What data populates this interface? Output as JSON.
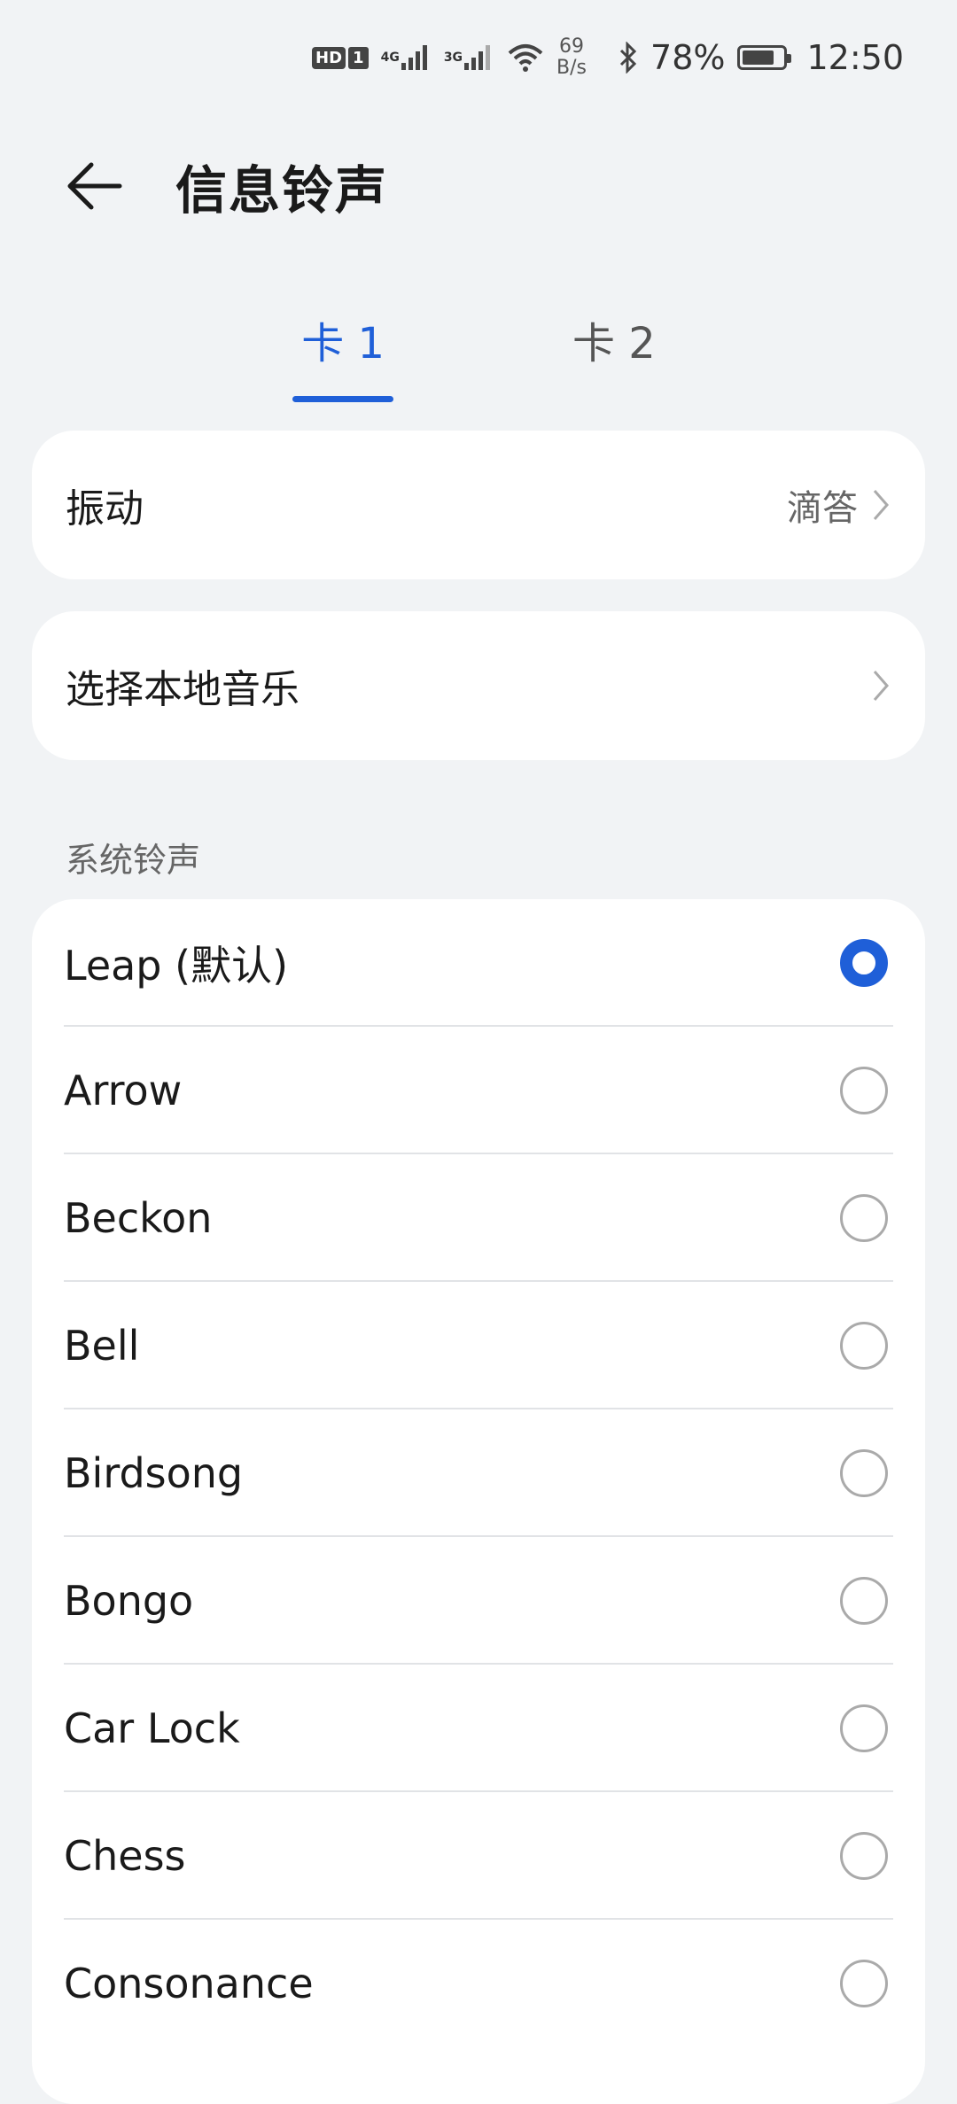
{
  "status_bar": {
    "hd": "HD",
    "sim": "1",
    "net1": "4G",
    "net2": "3G",
    "speed_value": "69",
    "speed_unit": "B/s",
    "battery": "78%",
    "time": "12:50",
    "battery_level": 0.78
  },
  "header": {
    "title": "信息铃声"
  },
  "tabs": [
    {
      "label": "卡 1",
      "active": true
    },
    {
      "label": "卡 2",
      "active": false
    }
  ],
  "vibration": {
    "label": "振动",
    "value": "滴答"
  },
  "local_music": {
    "label": "选择本地音乐"
  },
  "system_section": {
    "title": "系统铃声"
  },
  "ringtones": [
    {
      "label": "Leap (默认)",
      "selected": true
    },
    {
      "label": "Arrow",
      "selected": false
    },
    {
      "label": "Beckon",
      "selected": false
    },
    {
      "label": "Bell",
      "selected": false
    },
    {
      "label": "Birdsong",
      "selected": false
    },
    {
      "label": "Bongo",
      "selected": false
    },
    {
      "label": "Car Lock",
      "selected": false
    },
    {
      "label": "Chess",
      "selected": false
    },
    {
      "label": "Consonance",
      "selected": false
    }
  ],
  "colors": {
    "accent": "#1f5fd8",
    "background": "#f1f3f5"
  }
}
